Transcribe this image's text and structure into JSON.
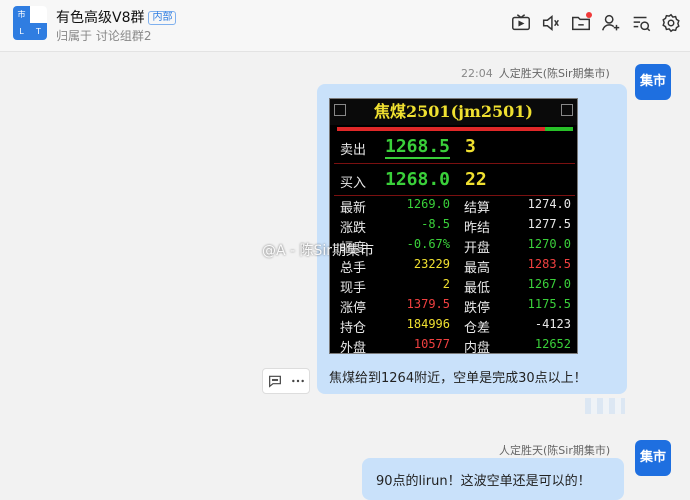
{
  "header": {
    "avatar_cells": [
      "市",
      "",
      "L",
      "T"
    ],
    "title": "有色高级V8群",
    "badge": "内部",
    "subtitle": "归属于 讨论组群2",
    "tools": [
      "tv-icon",
      "speaker-icon",
      "folder-icon",
      "add-user-icon",
      "history-icon",
      "settings-icon"
    ]
  },
  "messages": [
    {
      "time": "22:04",
      "sender": "人定胜天(陈Sir期集市)",
      "avatar_text": "集市",
      "image": {
        "title": "焦煤2501(jm2501)",
        "sell_label": "卖出",
        "sell_price": "1268.5",
        "sell_volume": "3",
        "buy_label": "买入",
        "buy_price": "1268.0",
        "buy_volume": "22",
        "rows": [
          {
            "k1": "最新",
            "v1": "1269.0",
            "k2": "结算",
            "v2": "1274.0"
          },
          {
            "k1": "涨跌",
            "v1": "-8.5",
            "k2": "昨结",
            "v2": "1277.5"
          },
          {
            "k1": "幅度",
            "v1": "-0.67%",
            "k2": "开盘",
            "v2": "1270.0"
          },
          {
            "k1": "总手",
            "v1": "23229",
            "k2": "最高",
            "v2": "1283.5"
          },
          {
            "k1": "现手",
            "v1": "2",
            "k2": "最低",
            "v2": "1267.0"
          },
          {
            "k1": "涨停",
            "v1": "1379.5",
            "k2": "跌停",
            "v2": "1175.5"
          },
          {
            "k1": "持仓",
            "v1": "184996",
            "k2": "仓差",
            "v2": "-4123"
          },
          {
            "k1": "外盘",
            "v1": "10577",
            "k2": "内盘",
            "v2": "12652"
          }
        ]
      },
      "watermark": "@A - 陈Sir期集市",
      "text": "焦煤给到1264附近，空单是完成30点以上！"
    },
    {
      "sender": "人定胜天(陈Sir期集市)",
      "avatar_text": "集市",
      "text": "90点的lirun！这波空单还是可以的！"
    }
  ],
  "hover_tools": [
    "comment-icon",
    "more-icon"
  ],
  "colors": {
    "bubble": "#c9e1fa",
    "avatar": "#1e6fe0",
    "quote_green": "#3ad03a",
    "quote_red": "#f04040",
    "quote_yellow": "#f0e030"
  }
}
